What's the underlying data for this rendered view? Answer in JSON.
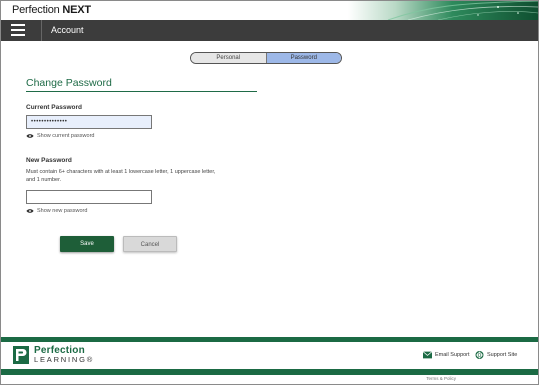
{
  "brand": {
    "logo_main": "Perfection ",
    "logo_next": "NEXT"
  },
  "topnav": {
    "menu_icon": "hamburger-icon",
    "title": "Account"
  },
  "tabs": {
    "personal": "Personal",
    "password": "Password",
    "selected": "Password"
  },
  "form": {
    "heading": "Change Password",
    "current_label": "Current Password",
    "current_value": "••••••••••••••",
    "show_current": "Show current password",
    "new_label": "New Password",
    "hint_line1": "Must contain 6+ characters with at least 1 lowercase letter, 1 uppercase letter,",
    "hint_line2": "and 1 number.",
    "new_value": "",
    "show_new": "Show new password",
    "save": "Save",
    "cancel": "Cancel"
  },
  "footer": {
    "logo_name": "Perfection",
    "logo_sub": "LEARNING®",
    "email_support": "Email Support",
    "support_site": "Support Site",
    "small_text": "Terms & Policy"
  },
  "colors": {
    "brand_green": "#1b6a44",
    "heading_green": "#1f6b47",
    "nav_dark": "#3c3c3c",
    "selected_tab": "#9db8e8",
    "input_filled": "#e8effc"
  }
}
